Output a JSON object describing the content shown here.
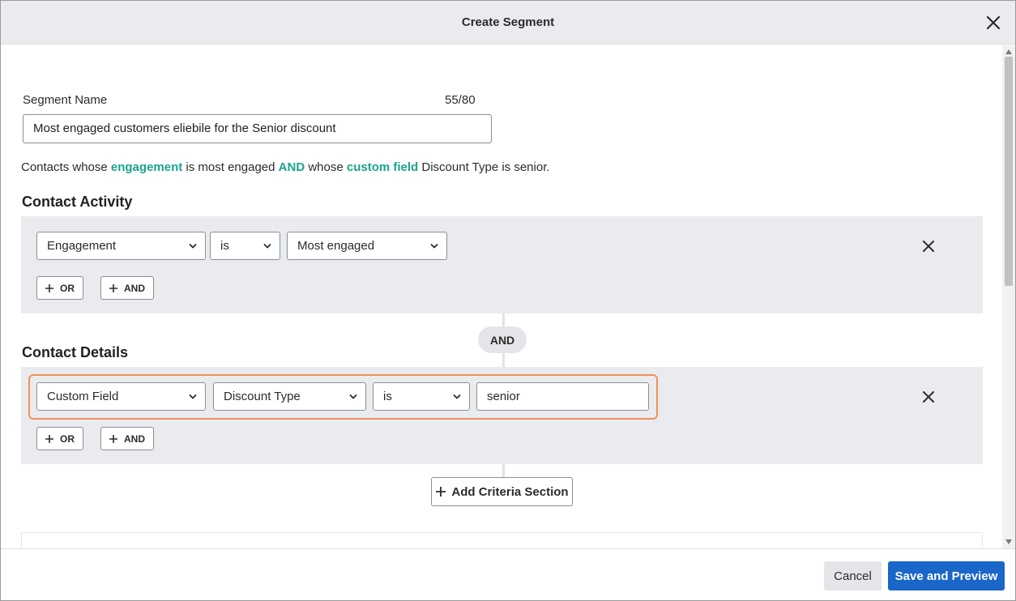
{
  "dialog": {
    "title": "Create Segment"
  },
  "segment_name": {
    "label": "Segment Name",
    "count": "55/80",
    "value": "Most engaged customers eliebile for the Senior discount"
  },
  "summary": {
    "part1": "Contacts whose ",
    "link1": "engagement",
    "part2": " is most engaged ",
    "and": "AND",
    "part3": " whose ",
    "link2": "custom field",
    "part4": " Discount Type is senior."
  },
  "contact_activity": {
    "title": "Contact Activity",
    "field": "Engagement",
    "operator": "is",
    "value": "Most engaged",
    "or_label": "OR",
    "and_label": "AND"
  },
  "connector": {
    "label": "AND"
  },
  "contact_details": {
    "title": "Contact Details",
    "field": "Custom Field",
    "subfield": "Discount Type",
    "operator": "is",
    "value": "senior",
    "or_label": "OR",
    "and_label": "AND"
  },
  "add_criteria": {
    "label": "Add Criteria Section"
  },
  "footer": {
    "cancel_label": "Cancel",
    "save_label": "Save and Preview"
  },
  "colors": {
    "accent_link": "#1aa38f",
    "primary_button": "#1a66c9",
    "highlight_border": "#f0915a",
    "panel_bg": "#e9ebee"
  },
  "icons": {
    "close": "close-icon",
    "chevron": "chevron-down-icon",
    "plus": "plus-icon",
    "remove": "remove-row-icon"
  }
}
